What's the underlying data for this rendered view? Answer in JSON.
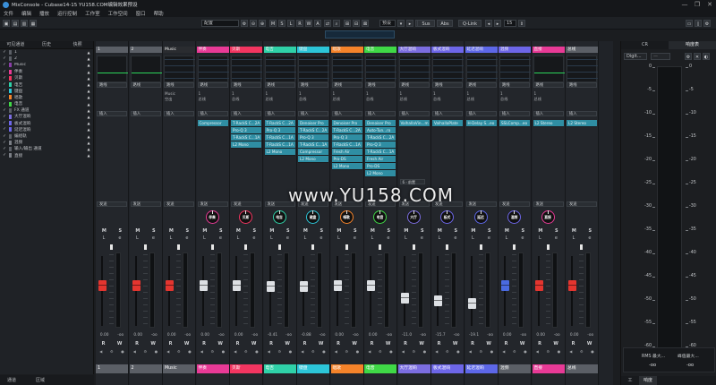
{
  "window": {
    "title": "MixConsole - Cubase14-15 YU158.COM编辑效果预设",
    "controls": [
      "—",
      "❐",
      "✕"
    ]
  },
  "menu": [
    "文件",
    "编辑",
    "播放",
    "运行控制",
    "工作室",
    "工作空间",
    "窗口",
    "帮助"
  ],
  "toolbar": {
    "config": "配置",
    "buttons": [
      "M",
      "S",
      "L",
      "R",
      "W",
      "A"
    ],
    "preset": "预设",
    "sus_label": "Sus",
    "abs_label": "Abs",
    "qlink_label": "Q-Link",
    "width_value": "15"
  },
  "left_panel": {
    "tabs": [
      "可见通道",
      "历史",
      "快照"
    ],
    "items": [
      {
        "check": "✓",
        "name": "1",
        "color": "#5b5f66"
      },
      {
        "check": "✓",
        "name": "2",
        "color": "#5b5f66"
      },
      {
        "check": "✓",
        "name": "Music",
        "color": "#8b3ea8"
      },
      {
        "check": "✓",
        "name": "伴奏",
        "color": "#e83a96"
      },
      {
        "check": "✓",
        "name": "贝斯",
        "color": "#f23560"
      },
      {
        "check": "✓",
        "name": "电吉",
        "color": "#2fd1a8"
      },
      {
        "check": "✓",
        "name": "键盘",
        "color": "#2cc5d8"
      },
      {
        "check": "✓",
        "name": "唱歌",
        "color": "#f5832a"
      },
      {
        "check": "✓",
        "name": "电音",
        "color": "#3fd846"
      },
      {
        "check": "✓",
        "name": "FX 通道",
        "color": "#5b5f66"
      },
      {
        "check": "✓",
        "name": "大厅混响",
        "color": "#7b6de0"
      },
      {
        "check": "✓",
        "name": "板式混响",
        "color": "#6d66e8"
      },
      {
        "check": "✓",
        "name": "延迟混响",
        "color": "#6d66e8"
      },
      {
        "check": "✓",
        "name": "编组轨",
        "color": "#5b5f66"
      },
      {
        "check": "✓",
        "name": "混频",
        "color": "#7b7f86"
      },
      {
        "check": "✓",
        "name": "输入/输出 通道",
        "color": "#5b5f66"
      },
      {
        "check": "✓",
        "name": "直接",
        "color": "#7b7f86"
      }
    ],
    "footer": [
      "通道",
      "区域"
    ]
  },
  "strips": [
    {
      "name": "1",
      "color": "#5b5f66",
      "route": "路线",
      "info": [],
      "ins_label": "插入",
      "plugins": [],
      "send_label": "发送",
      "knob": "",
      "meter": "#2bd55a",
      "fader": "#e3352f",
      "vals": [
        "0.00",
        "-oo"
      ],
      "foot": "1",
      "foot_color": "#5b5f66"
    },
    {
      "name": "2",
      "color": "#5b5f66",
      "route": "路线",
      "info": [],
      "ins_label": "插入",
      "plugins": [],
      "send_label": "发送",
      "knob": "",
      "meter": "#2bd55a",
      "fader": "#e3352f",
      "vals": [
        "0.00",
        "-oo"
      ],
      "foot": "2",
      "foot_color": "#5b5f66"
    },
    {
      "name": "Music",
      "color": "#2a2c30",
      "route": "路线",
      "info": [
        "Music",
        "空出"
      ],
      "ins_label": "插入",
      "plugins": [],
      "send_label": "发送",
      "knob": "",
      "meter": "",
      "fader": "#e3352f",
      "vals": [
        "0.00",
        "-oo"
      ],
      "foot": "Music",
      "foot_color": "#5b5f66"
    },
    {
      "name": "伴奏",
      "color": "#e83a96",
      "route": "路线",
      "info": [
        "1",
        "总线"
      ],
      "ins_label": "插入",
      "plugins": [
        "Compressor"
      ],
      "send_label": "发送",
      "knob": "伴奏",
      "meter": "",
      "fader": "#dde0e4",
      "vals": [
        "0.00",
        "-oo"
      ],
      "foot": "伴奏",
      "foot_color": "#e83a96"
    },
    {
      "name": "贝斯",
      "color": "#f23560",
      "route": "路线",
      "info": [
        "1",
        "总线"
      ],
      "ins_label": "插入",
      "plugins": [
        "T-RackS C...2A",
        "Pro-Q 3",
        "T-RackS C...1A",
        "L2 Mono"
      ],
      "send_label": "发送",
      "knob": "贝斯",
      "meter": "",
      "fader": "#dde0e4",
      "vals": [
        "0.00",
        "-oo"
      ],
      "foot": "贝斯",
      "foot_color": "#f23560"
    },
    {
      "name": "电吉",
      "color": "#2fd1a8",
      "route": "路线",
      "info": [
        "1",
        "总线"
      ],
      "ins_label": "插入",
      "plugins": [
        "T-RackS C...2A",
        "Pro-Q 3",
        "T-RackS C...1A",
        "T-RackS C...1A",
        "L2 Mono"
      ],
      "send_label": "发送",
      "knob": "电吉",
      "meter": "",
      "fader": "#dde0e4",
      "vals": [
        "-0.41",
        "-oo"
      ],
      "foot": "电吉",
      "foot_color": "#2fd1a8"
    },
    {
      "name": "键盘",
      "color": "#2cc5d8",
      "route": "路线",
      "info": [
        "1",
        "总线"
      ],
      "ins_label": "插入",
      "plugins": [
        "Denoiser Pro",
        "T-RackS C...2A",
        "Pro-Q 3",
        "T-RackS C...1A",
        "Compressor",
        "L2 Mono"
      ],
      "send_label": "发送",
      "knob": "键盘",
      "meter": "",
      "fader": "#dde0e4",
      "vals": [
        "-0.88",
        "-oo"
      ],
      "foot": "键盘",
      "foot_color": "#2cc5d8"
    },
    {
      "name": "唱歌",
      "color": "#f5832a",
      "route": "路线",
      "info": [
        "1",
        "总线"
      ],
      "ins_label": "插入",
      "plugins": [
        "Denoiser Pro",
        "T-RackS C...2A",
        "Pro-Q 3",
        "T-RackS C...1A",
        "Fresh Air",
        "Pro-DS",
        "L2 Mono"
      ],
      "send_label": "发送",
      "knob": "唱歌",
      "meter": "",
      "fader": "#dde0e4",
      "vals": [
        "0.00",
        "-oo"
      ],
      "foot": "唱歌",
      "foot_color": "#f5832a"
    },
    {
      "name": "电音",
      "color": "#3fd846",
      "route": "路线",
      "info": [
        "1",
        "总线"
      ],
      "ins_label": "插入",
      "plugins": [
        "Denoiser Pro",
        "Auto-Tun...ro",
        "T-RackS C...2A",
        "Pro-Q 3",
        "T-RackS C...1A",
        "Fresh Air",
        "Pro-DS",
        "L2 Mono"
      ],
      "send_label": "发送",
      "knob": "电音",
      "meter": "",
      "fader": "#dde0e4",
      "vals": [
        "0.00",
        "-oo"
      ],
      "foot": "电音",
      "foot_color": "#3fd846"
    },
    {
      "name": "大厅混响",
      "color": "#7b6de0",
      "route": "路线",
      "info": [
        "1",
        "总线"
      ],
      "ins_label": "插入",
      "plugins": [
        "ValhallaVin...m"
      ],
      "send_label": "发送",
      "knob": "大厅",
      "meter": "",
      "fader": "#dde0e4",
      "dd": "6 - 前置",
      "vals": [
        "-11.0",
        "-oo"
      ],
      "foot": "大厅混响",
      "foot_color": "#7b6de0"
    },
    {
      "name": "板式混响",
      "color": "#6d66e8",
      "route": "路线",
      "info": [
        "1",
        "总线"
      ],
      "ins_label": "插入",
      "plugins": [
        "ValhallaPlate"
      ],
      "send_label": "发送",
      "knob": "板式",
      "meter": "",
      "fader": "#dde0e4",
      "vals": [
        "-15.7",
        "-oo"
      ],
      "foot": "板式混响",
      "foot_color": "#6d66e8"
    },
    {
      "name": "延迟混响",
      "color": "#5d67e8",
      "route": "路线",
      "info": [
        "1",
        "总线"
      ],
      "ins_label": "插入",
      "plugins": [
        "H-Delay S...eo"
      ],
      "send_label": "发送",
      "knob": "延迟",
      "meter": "",
      "fader": "#dde0e4",
      "vals": [
        "-19.1",
        "-oo"
      ],
      "foot": "延迟混响",
      "foot_color": "#5d67e8"
    },
    {
      "name": "混频",
      "color": "#6d66e8",
      "route": "路线",
      "info": [
        "1",
        "总线"
      ],
      "ins_label": "插入",
      "plugins": [
        "SSLComp...eo"
      ],
      "send_label": "发送",
      "knob": "混频",
      "meter": "",
      "fader": "#4a6ae0",
      "vals": [
        "0.00",
        "-oo"
      ],
      "foot": "混频",
      "foot_color": "#5b5f66"
    },
    {
      "name": "直接",
      "color": "#e83a96",
      "route": "路线",
      "info": [
        "1",
        "总线"
      ],
      "ins_label": "插入",
      "plugins": [
        "L2 Stereo"
      ],
      "send_label": "发送",
      "knob": "直接",
      "meter": "#2bd55a",
      "fader": "#e3352f",
      "vals": [
        "0.00",
        "-oo"
      ],
      "foot": "直接",
      "foot_color": "#e83a96"
    },
    {
      "name": "总线",
      "color": "#5b5f66",
      "route": "路线",
      "info": [],
      "ins_label": "插入",
      "plugins": [
        "L2 Stereo"
      ],
      "send_label": "发送",
      "knob": "",
      "meter": "",
      "fader": "#e3352f",
      "vals": [
        "0.00",
        "-oo"
      ],
      "foot": "总线",
      "foot_color": "#5b5f66"
    }
  ],
  "strip_common": {
    "ms": [
      "M",
      "S"
    ],
    "le": [
      "L",
      "e"
    ],
    "rw": [
      "R",
      "W"
    ]
  },
  "right_panel": {
    "tabs": [
      "CR",
      "响度表"
    ],
    "active_tab": "响度表",
    "mode": "Digit...",
    "scale": [
      "0",
      "-5",
      "-10",
      "-15",
      "-20",
      "-25",
      "-30",
      "-35",
      "-40",
      "-45",
      "-50",
      "-55",
      "-60"
    ],
    "rms_label": "RMS 最大...",
    "rms_value": "-oo",
    "peak_label": "峰值最大...",
    "peak_value": "-oo",
    "bottom_tabs": [
      "工",
      "响度"
    ]
  },
  "watermark": "www.YU158.COM"
}
